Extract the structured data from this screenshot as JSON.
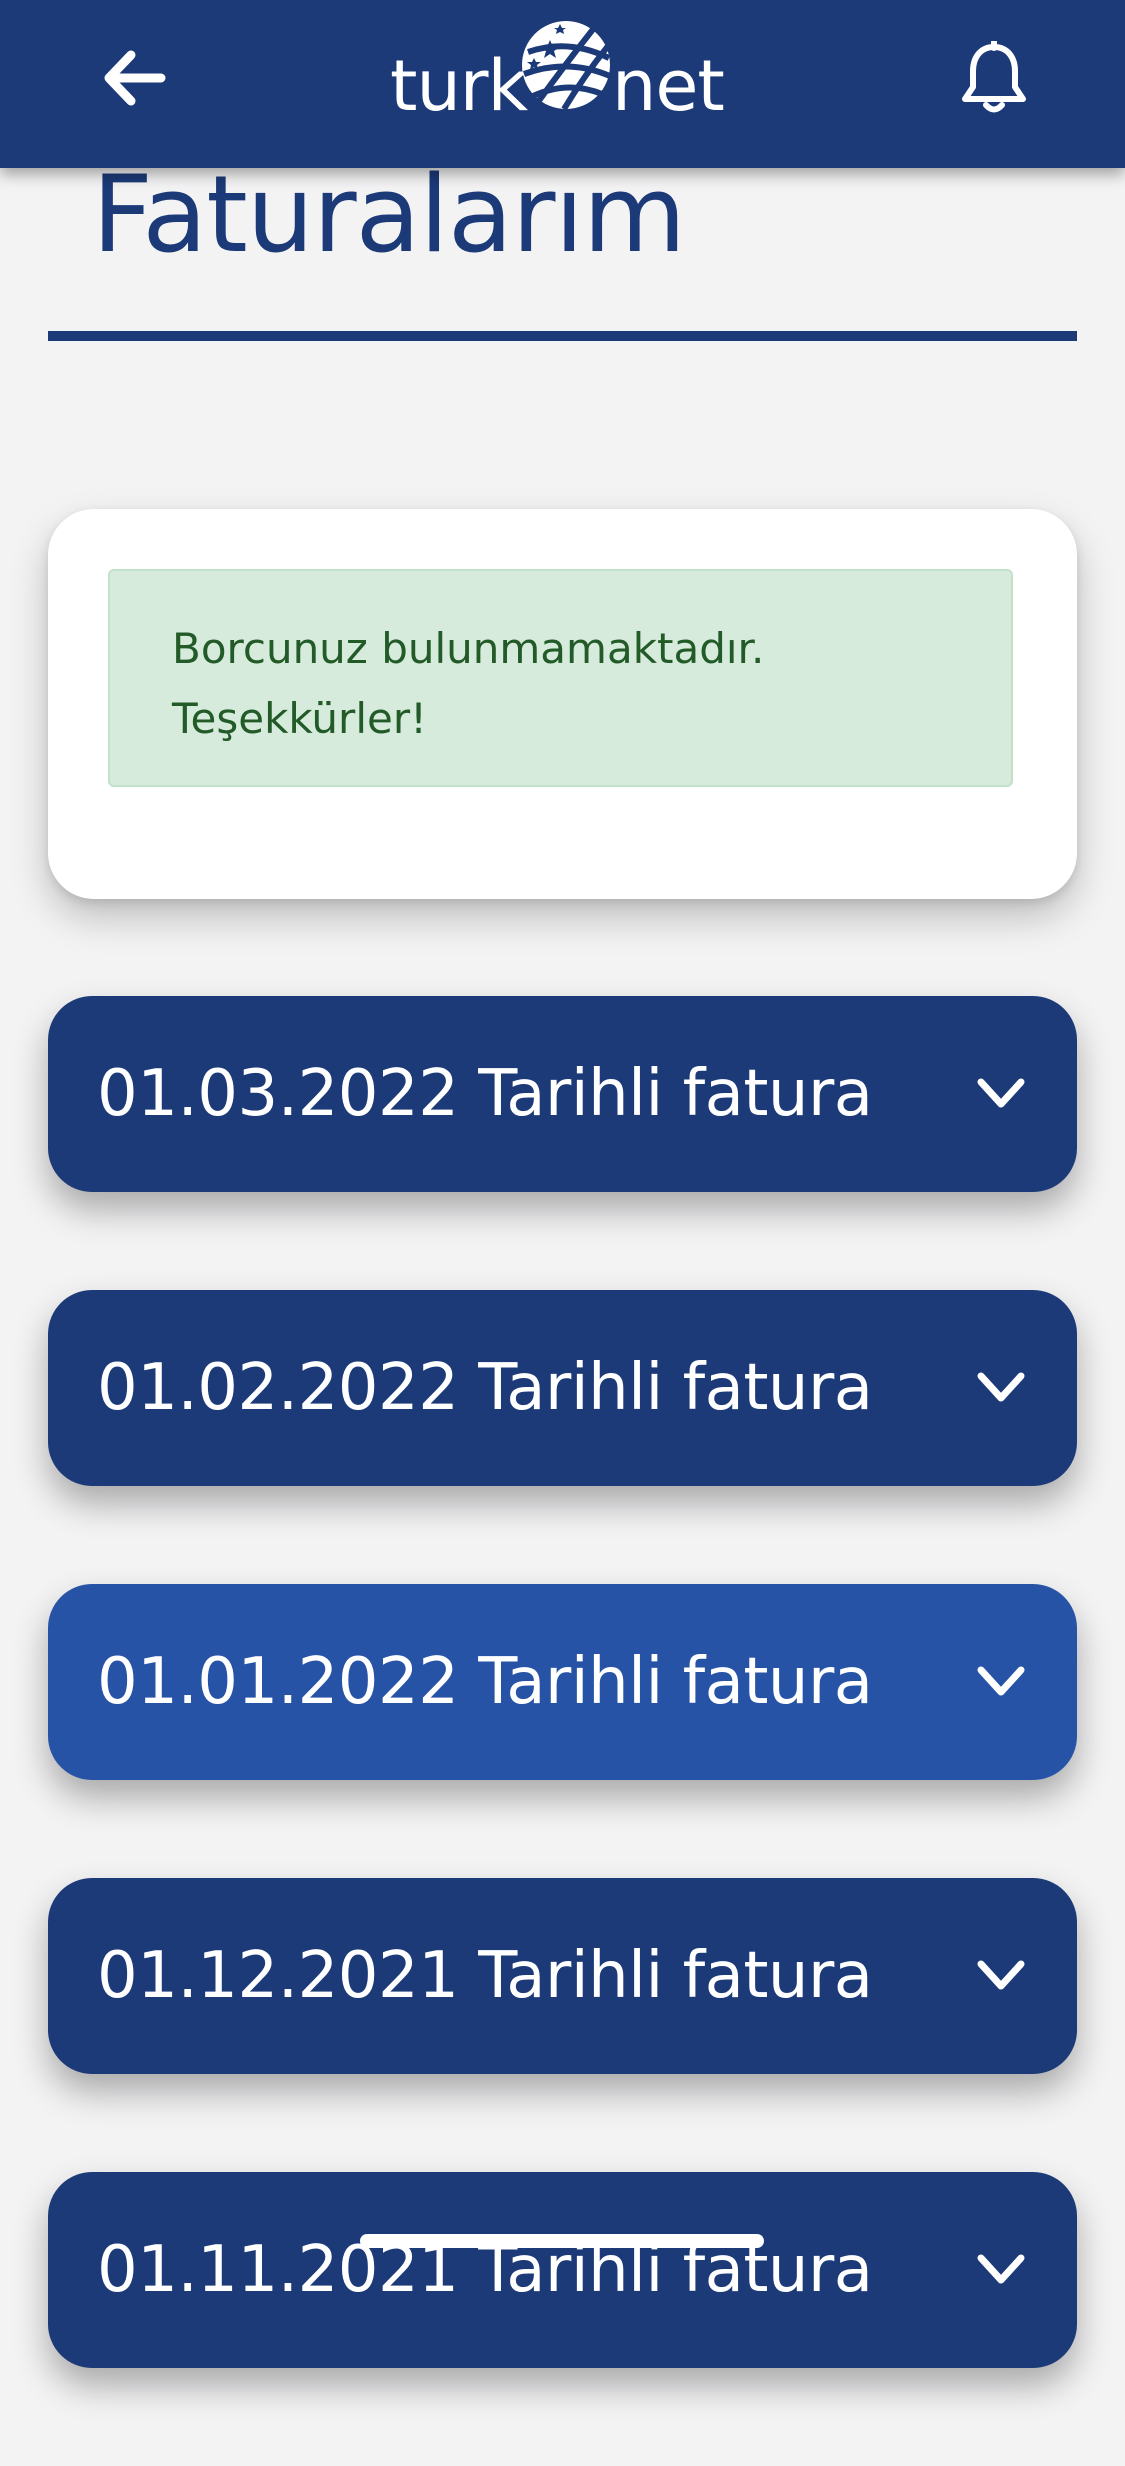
{
  "header": {
    "logo_left": "turk",
    "logo_right": "net",
    "back_icon": "arrow-left-icon",
    "notification_icon": "bell-icon"
  },
  "page": {
    "title": "Faturalarım"
  },
  "alert": {
    "line1": "Borcunuz bulunmamaktadır.",
    "line2": "Teşekkürler!"
  },
  "invoices": [
    {
      "label": "01.03.2022 Tarihli fatura",
      "icon": "chevron-down-icon"
    },
    {
      "label": "01.02.2022 Tarihli fatura",
      "icon": "chevron-down-icon"
    },
    {
      "label": "01.01.2022 Tarihli fatura",
      "icon": "chevron-down-icon"
    },
    {
      "label": "01.12.2021 Tarihli fatura",
      "icon": "chevron-down-icon"
    },
    {
      "label": "01.11.2021 Tarihli fatura",
      "icon": "chevron-down-icon"
    }
  ],
  "colors": {
    "brand_navy": "#1c3a78",
    "selected_blue": "#2753a6",
    "alert_bg": "#d6ebdc",
    "alert_text": "#225a28",
    "page_bg": "#f3f3f4"
  }
}
